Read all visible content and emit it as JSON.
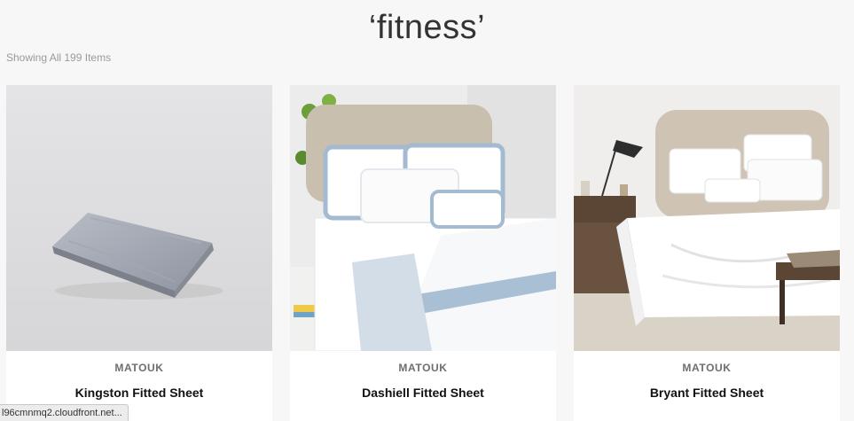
{
  "search": {
    "title": "‘fitness’",
    "result_count": "Showing All 199 Items"
  },
  "products": [
    {
      "brand": "MATOUK",
      "name": "Kingston Fitted Sheet",
      "image": "folded-gray-sheet"
    },
    {
      "brand": "MATOUK",
      "name": "Dashiell Fitted Sheet",
      "image": "bed-white-blue-trim"
    },
    {
      "brand": "MATOUK",
      "name": "Bryant Fitted Sheet",
      "image": "bed-white-linen"
    }
  ],
  "status_bar": {
    "url": "l96cmnmq2.cloudfront.net..."
  },
  "colors": {
    "background": "#f7f7f7",
    "card": "#ffffff",
    "brand_text": "#6e6e6e",
    "accent_blue_trim": "#9fb6cc"
  }
}
